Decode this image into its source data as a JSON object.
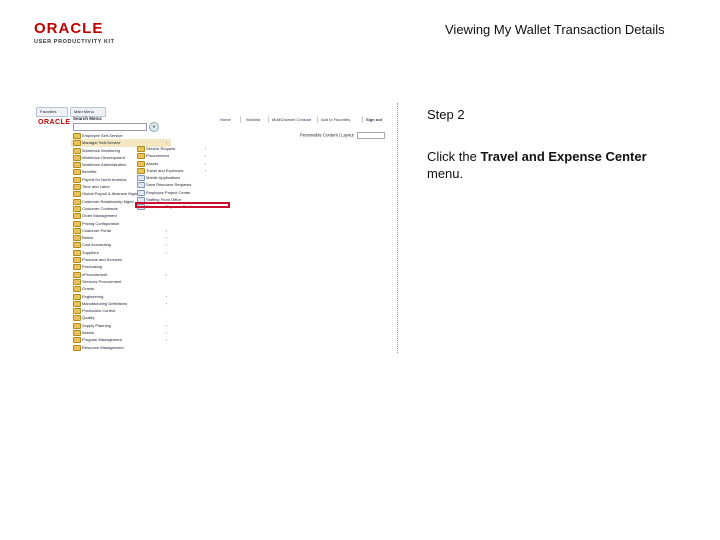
{
  "logo": {
    "wordmark": "ORACLE",
    "subtitle": "USER PRODUCTIVITY KIT"
  },
  "slide_title": "Viewing My Wallet Transaction Details",
  "step": {
    "label": "Step 2"
  },
  "instruction": {
    "prefix": "Click the ",
    "target": "Travel and Expense Center",
    "suffix": " menu."
  },
  "screenshot": {
    "tabs": {
      "favorites": "Favorites",
      "main_menu": "Main Menu"
    },
    "oracle_small": "ORACLE",
    "nav_links": [
      "Home",
      "Worklist",
      "MultiChannel Console",
      "Add to Favorites",
      "Sign out"
    ],
    "personalize": "Personalize Content | Layout",
    "search_label": "Search Menu:",
    "main_menu_items": [
      "Employee Self-Service",
      "Manager Self-Service",
      "Workforce Monitoring",
      "Workforce Development",
      "Workforce Administration",
      "Benefits",
      "Payroll for North America",
      "Time and Labor",
      "Global Payroll & Absence Mgmt",
      "Customer Relationship Mgmt",
      "Customer Contracts",
      "Order Management",
      "Pricing Configuration",
      "Customer Portal",
      "Banks",
      "Cost Accounting",
      "Suppliers",
      "Products and Services",
      "Purchasing",
      "eProcurement",
      "Services Procurement",
      "Grants",
      "Engineering",
      "Manufacturing Definitions",
      "Production Control",
      "Quality",
      "Supply Planning",
      "Assets",
      "Program Management",
      "Resource Management"
    ],
    "submenu_items": [
      "Service Request",
      "Procurement",
      "Assets",
      "Travel and Expenses",
      "Mobile Applications",
      "Save Resource Requests",
      "Employee Project Center",
      "Staffing Front Office",
      "Travel and Expense Center"
    ]
  }
}
